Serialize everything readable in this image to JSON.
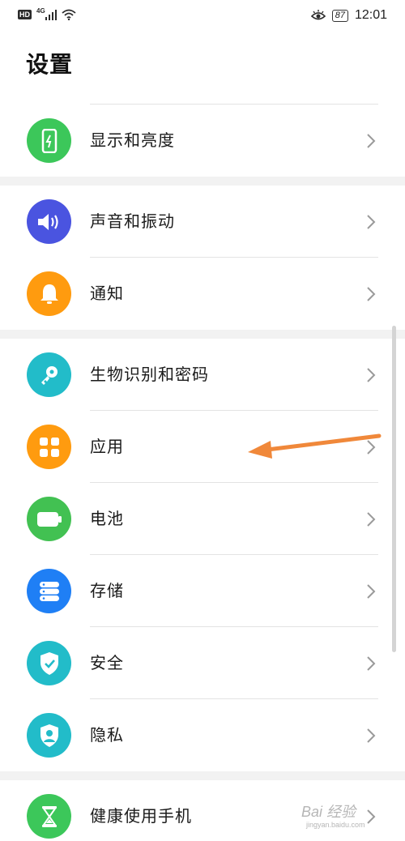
{
  "status_bar": {
    "hd_label": "HD",
    "network_label": "4G",
    "battery_level": "87",
    "time": "12:01"
  },
  "page": {
    "title": "设置"
  },
  "groups": [
    {
      "items": [
        {
          "label": "显示和亮度",
          "icon": "display-icon",
          "color": "#3cc75a"
        }
      ]
    },
    {
      "items": [
        {
          "label": "声音和振动",
          "icon": "speaker-icon",
          "color": "#4a54e0"
        },
        {
          "label": "通知",
          "icon": "bell-icon",
          "color": "#ff9b0f"
        }
      ]
    },
    {
      "items": [
        {
          "label": "生物识别和密码",
          "icon": "key-icon",
          "color": "#22bcc9"
        },
        {
          "label": "应用",
          "icon": "apps-grid-icon",
          "color": "#ff9b0f"
        },
        {
          "label": "电池",
          "icon": "battery-icon",
          "color": "#42c152"
        },
        {
          "label": "存储",
          "icon": "storage-icon",
          "color": "#1f7ff5"
        },
        {
          "label": "安全",
          "icon": "shield-check-icon",
          "color": "#22bcc9"
        },
        {
          "label": "隐私",
          "icon": "privacy-shield-icon",
          "color": "#22bcc9"
        }
      ]
    },
    {
      "items": [
        {
          "label": "健康使用手机",
          "icon": "hourglass-icon",
          "color": "#3cc75a"
        }
      ]
    }
  ],
  "annotation": {
    "arrow_color": "#f0883a"
  },
  "watermark": {
    "text": "Bai 经验",
    "sub": "jingyan.baidu.com"
  }
}
